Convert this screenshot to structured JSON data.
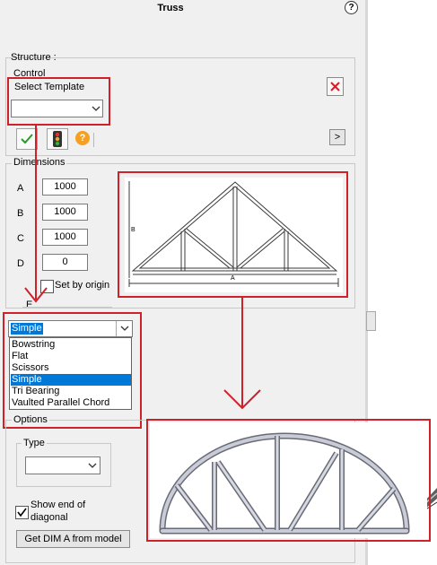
{
  "window": {
    "title": "Truss",
    "help_glyph": "?"
  },
  "structure": {
    "heading": "Structure :",
    "control_label": "Control",
    "select_template_label": "Select Template",
    "template_value": "",
    "next_label": ">"
  },
  "dimensions": {
    "heading": "Dimensions",
    "fields": [
      {
        "label": "A",
        "value": "1000"
      },
      {
        "label": "B",
        "value": "1000"
      },
      {
        "label": "C",
        "value": "1000"
      },
      {
        "label": "D",
        "value": "0"
      }
    ],
    "set_by_origin_label": "Set by origin",
    "set_by_origin_checked": false,
    "e_label": "E"
  },
  "truss_type": {
    "selected": "Simple",
    "options": [
      "Bowstring",
      "Flat",
      "Scissors",
      "Simple",
      "Tri Bearing",
      "Vaulted Parallel Chord"
    ],
    "selected_index": 3
  },
  "options": {
    "heading": "Options",
    "type_label": "Type",
    "type_value": "",
    "show_end_label_line1": "Show end of",
    "show_end_label_line2": "diagonal",
    "show_end_checked": true,
    "get_dim_button": "Get DIM A from model"
  },
  "preview": {
    "label_a": "A",
    "label_b": "B"
  },
  "colors": {
    "annotation_red": "#d0202a",
    "selection_blue": "#0078d7"
  },
  "icons": [
    "close-icon",
    "check-icon",
    "traffic-light-icon",
    "help-icon",
    "chevron-down-icon"
  ]
}
